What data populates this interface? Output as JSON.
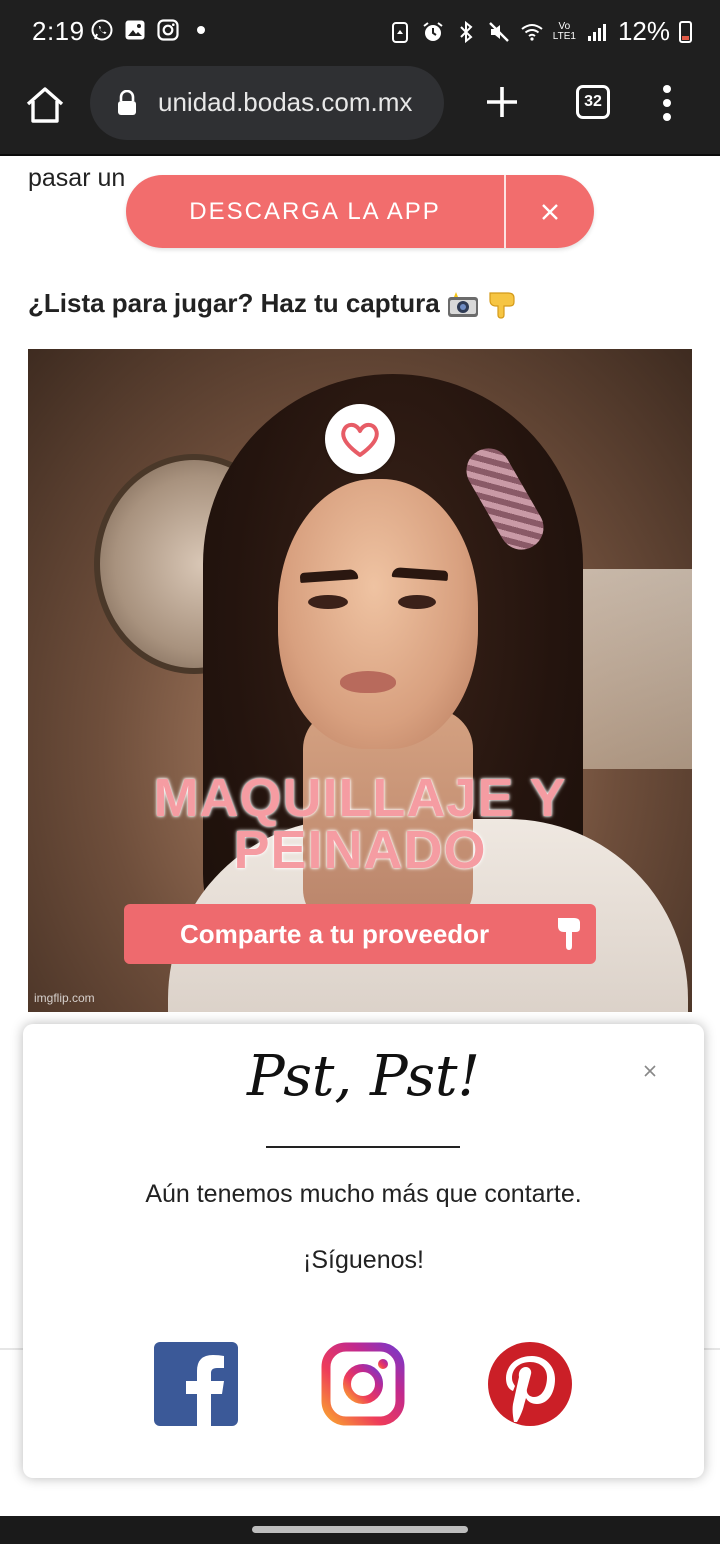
{
  "status_bar": {
    "time": "2:19",
    "battery": "12%",
    "network_top": "Vo",
    "network_bottom": "LTE1",
    "left_icons": [
      "whatsapp-icon",
      "gallery-icon",
      "instagram-icon",
      "dot-icon"
    ],
    "right_icons": [
      "recycle-icon",
      "alarm-icon",
      "bluetooth-icon",
      "mute-icon",
      "wifi-icon",
      "signal-icon",
      "battery-icon"
    ]
  },
  "browser": {
    "url": "unidad.bodas.com.mx",
    "tab_count": "32"
  },
  "article": {
    "cut_text": "pasar un",
    "app_banner_label": "DESCARGA LA APP",
    "heading": "¿Lista para jugar? Haz tu captura"
  },
  "hero": {
    "title_line1": "MAQUILLAJE Y",
    "title_line2": "PEINADO",
    "cta": "Comparte a tu proveedor",
    "watermark": "imgflip.com"
  },
  "modal": {
    "title": "Pst, Pst!",
    "text": "Aún tenemos mucho más que contarte.",
    "follow": "¡Síguenos!",
    "social": [
      "facebook-icon",
      "instagram-icon",
      "pinterest-icon"
    ]
  },
  "colors": {
    "brand_coral": "#f26d6d",
    "chrome_dark": "#1f1f1f",
    "facebook": "#3b5998",
    "pinterest": "#cb1f27"
  }
}
